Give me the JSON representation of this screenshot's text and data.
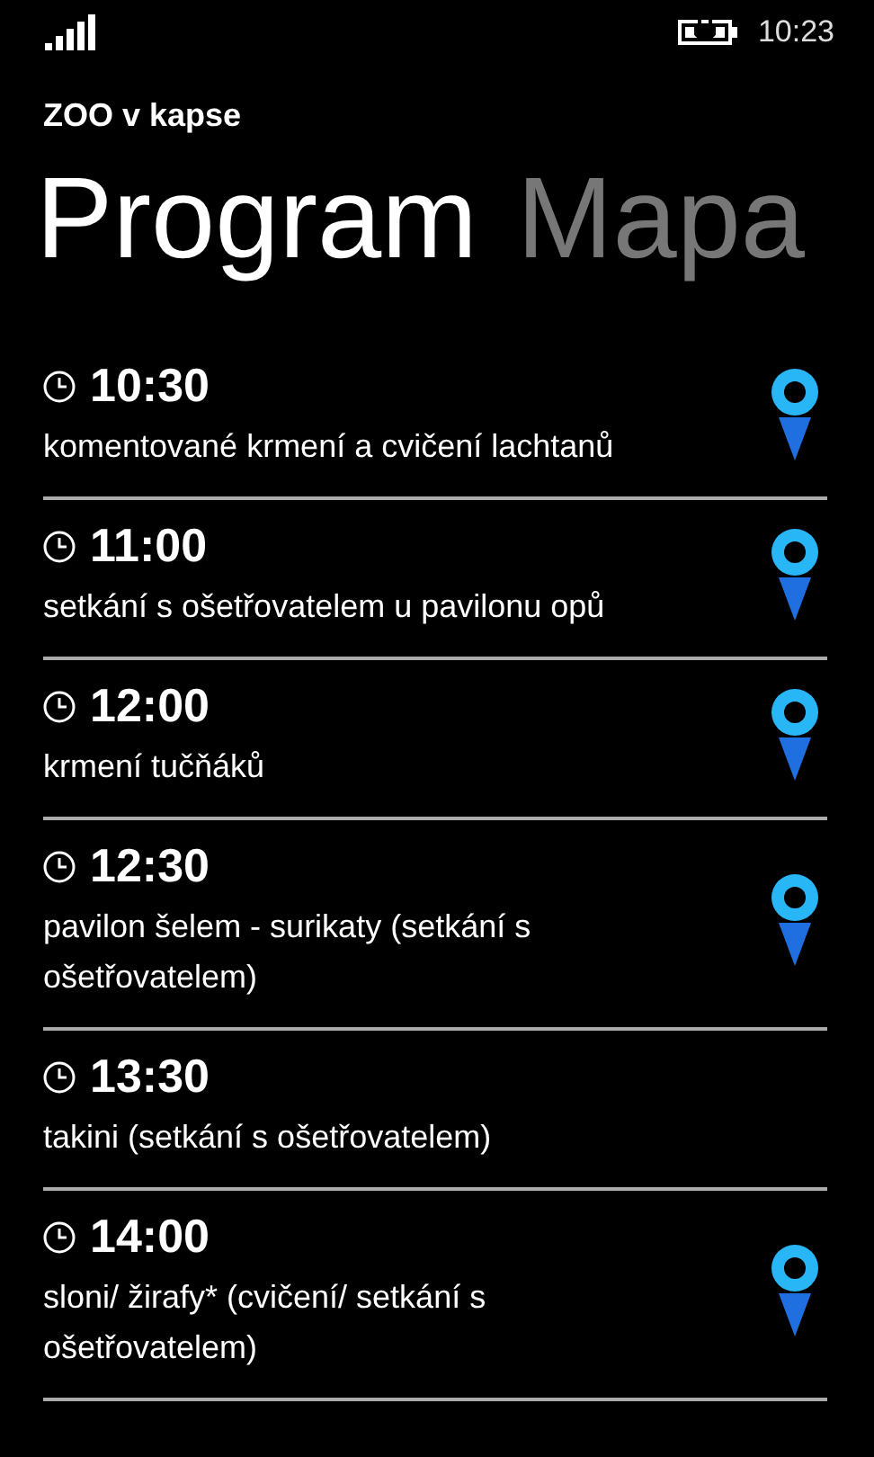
{
  "status_bar": {
    "time": "10:23"
  },
  "app_title": "ZOO v kapse",
  "pivot": [
    {
      "label": "Program",
      "selected": true
    },
    {
      "label": "Mapa",
      "selected": false
    }
  ],
  "events": [
    {
      "time": "10:30",
      "title": "komentované krmení a cvičení lachtanů",
      "has_location": true
    },
    {
      "time": "11:00",
      "title": "setkání s ošetřovatelem u pavilonu opů",
      "has_location": true
    },
    {
      "time": "12:00",
      "title": "krmení tučňáků",
      "has_location": true
    },
    {
      "time": "12:30",
      "title": "pavilon šelem - surikaty (setkání s ošetřovatelem)",
      "has_location": true
    },
    {
      "time": "13:30",
      "title": "takini (setkání s ošetřovatelem)",
      "has_location": false
    },
    {
      "time": "14:00",
      "title": "sloni/ žirafy* (cvičení/ setkání s ošetřovatelem)",
      "has_location": true
    }
  ]
}
